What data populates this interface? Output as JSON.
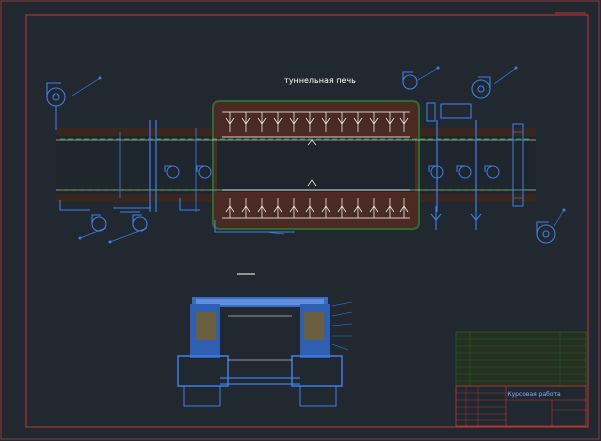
{
  "drawing": {
    "title": "туннельная печь",
    "title_block_text": "Курсовая работа"
  },
  "colors": {
    "background": "#212830",
    "outer_frame": "#9c3a3a",
    "inner_frame": "#c43a3a",
    "kiln_body": "#3a2620",
    "kiln_body_hot": "#5a1e1e",
    "hot_zone_border": "#2f6a2f",
    "equipment": "#3f7fe6",
    "axis_line": "#2fbf2f",
    "structure_lines": "#ffffff",
    "table_green": "#2f6a2f"
  },
  "icons": [
    "fan-icon",
    "burner-icon",
    "leader-arrow-icon"
  ]
}
